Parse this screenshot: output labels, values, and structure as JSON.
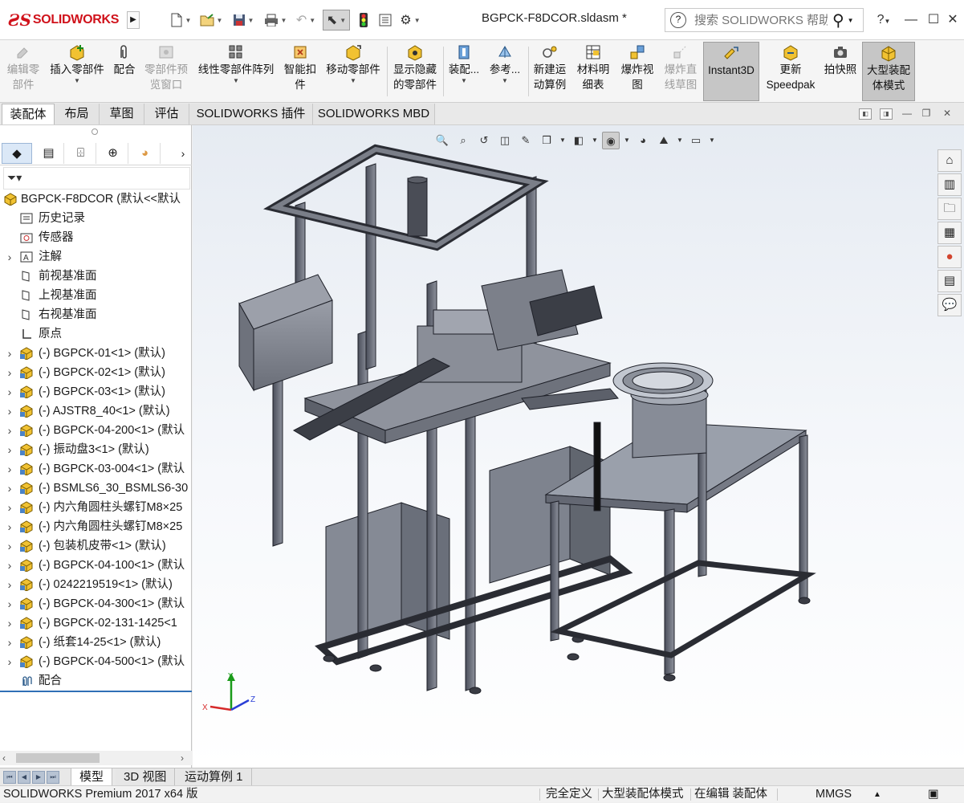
{
  "app": {
    "logo_text": "SOLIDWORKS",
    "document_title": "BGPCK-F8DCOR.sldasm *"
  },
  "help_search": {
    "placeholder": "搜索 SOLIDWORKS 帮助"
  },
  "toolbar": {
    "items": [
      {
        "label1": "编辑零",
        "label2": "部件",
        "icon": "edit-component-icon",
        "disabled": true
      },
      {
        "label1": "插入零部件",
        "label2": "",
        "icon": "insert-component-icon",
        "disabled": false
      },
      {
        "label1": "配合",
        "label2": "",
        "icon": "mate-icon",
        "disabled": false
      },
      {
        "label1": "零部件预",
        "label2": "览窗口",
        "icon": "preview-window-icon",
        "disabled": true
      },
      {
        "label1": "线性零部件阵列",
        "label2": "",
        "icon": "linear-pattern-icon",
        "disabled": false
      },
      {
        "label1": "智能扣",
        "label2": "件",
        "icon": "smart-fastener-icon",
        "disabled": false
      },
      {
        "label1": "移动零部件",
        "label2": "",
        "icon": "move-component-icon",
        "disabled": false
      },
      {
        "label1": "显示隐藏",
        "label2": "的零部件",
        "icon": "show-hidden-icon",
        "disabled": false
      },
      {
        "label1": "装配...",
        "label2": "",
        "icon": "assembly-feature-icon",
        "disabled": false
      },
      {
        "label1": "参考...",
        "label2": "",
        "icon": "reference-geometry-icon",
        "disabled": false
      },
      {
        "label1": "新建运",
        "label2": "动算例",
        "icon": "motion-study-icon",
        "disabled": false
      },
      {
        "label1": "材料明",
        "label2": "细表",
        "icon": "bom-icon",
        "disabled": false
      },
      {
        "label1": "爆炸视",
        "label2": "图",
        "icon": "exploded-view-icon",
        "disabled": false
      },
      {
        "label1": "爆炸直",
        "label2": "线草图",
        "icon": "explode-line-icon",
        "disabled": true
      },
      {
        "label1": "Instant3D",
        "label2": "",
        "icon": "instant3d-icon",
        "disabled": false,
        "active": true
      },
      {
        "label1": "更新",
        "label2": "Speedpak",
        "icon": "speedpak-icon",
        "disabled": false
      },
      {
        "label1": "拍快照",
        "label2": "",
        "icon": "snapshot-icon",
        "disabled": false
      },
      {
        "label1": "大型装配",
        "label2": "体模式",
        "icon": "large-assembly-icon",
        "disabled": false,
        "active": true
      }
    ]
  },
  "command_tabs": [
    "装配体",
    "布局",
    "草图",
    "评估",
    "SOLIDWORKS 插件",
    "SOLIDWORKS MBD"
  ],
  "tree": {
    "root": "BGPCK-F8DCOR  (默认<<默认",
    "items": [
      {
        "label": "历史记录",
        "icon": "history-icon",
        "expandable": false
      },
      {
        "label": "传感器",
        "icon": "sensor-icon",
        "expandable": false
      },
      {
        "label": "注解",
        "icon": "annotation-icon",
        "expandable": true
      },
      {
        "label": "前视基准面",
        "icon": "plane-icon",
        "expandable": false
      },
      {
        "label": "上视基准面",
        "icon": "plane-icon",
        "expandable": false
      },
      {
        "label": "右视基准面",
        "icon": "plane-icon",
        "expandable": false
      },
      {
        "label": "原点",
        "icon": "origin-icon",
        "expandable": false
      },
      {
        "label": "(-) BGPCK-01<1> (默认)",
        "icon": "subassembly-icon",
        "expandable": true
      },
      {
        "label": "(-) BGPCK-02<1> (默认)",
        "icon": "subassembly-icon",
        "expandable": true
      },
      {
        "label": "(-) BGPCK-03<1> (默认)",
        "icon": "subassembly-icon",
        "expandable": true
      },
      {
        "label": "(-) AJSTR8_40<1> (默认)",
        "icon": "subassembly-icon",
        "expandable": true
      },
      {
        "label": "(-) BGPCK-04-200<1> (默认",
        "icon": "subassembly-icon",
        "expandable": true
      },
      {
        "label": "(-) 振动盘3<1> (默认)",
        "icon": "subassembly-icon",
        "expandable": true
      },
      {
        "label": "(-) BGPCK-03-004<1> (默认",
        "icon": "subassembly-icon",
        "expandable": true
      },
      {
        "label": "(-) BSMLS6_30_BSMLS6-30",
        "icon": "subassembly-icon",
        "expandable": true
      },
      {
        "label": "(-) 内六角圆柱头螺钉M8×25",
        "icon": "subassembly-icon",
        "expandable": true
      },
      {
        "label": "(-) 内六角圆柱头螺钉M8×25",
        "icon": "subassembly-icon",
        "expandable": true
      },
      {
        "label": "(-) 包装机皮带<1> (默认)",
        "icon": "subassembly-icon",
        "expandable": true
      },
      {
        "label": "(-) BGPCK-04-100<1> (默认",
        "icon": "subassembly-icon",
        "expandable": true
      },
      {
        "label": "(-) 0242219519<1> (默认)",
        "icon": "subassembly-icon",
        "expandable": true
      },
      {
        "label": "(-) BGPCK-04-300<1> (默认",
        "icon": "subassembly-icon",
        "expandable": true
      },
      {
        "label": "(-) BGPCK-02-131-1425<1",
        "icon": "subassembly-icon",
        "expandable": true
      },
      {
        "label": "(-) 纸套14-25<1> (默认)",
        "icon": "subassembly-icon",
        "expandable": true
      },
      {
        "label": "(-) BGPCK-04-500<1> (默认",
        "icon": "subassembly-icon",
        "expandable": true
      },
      {
        "label": "配合",
        "icon": "mates-folder-icon",
        "expandable": false
      }
    ]
  },
  "triad": {
    "x": "X",
    "y": "Y",
    "z": "Z"
  },
  "bottom_tabs": [
    "模型",
    "3D 视图",
    "运动算例 1"
  ],
  "status": {
    "product": "SOLIDWORKS Premium 2017 x64 版",
    "definition": "完全定义",
    "mode": "大型装配体模式",
    "editing": "在编辑 装配体",
    "units": "MMGS"
  }
}
